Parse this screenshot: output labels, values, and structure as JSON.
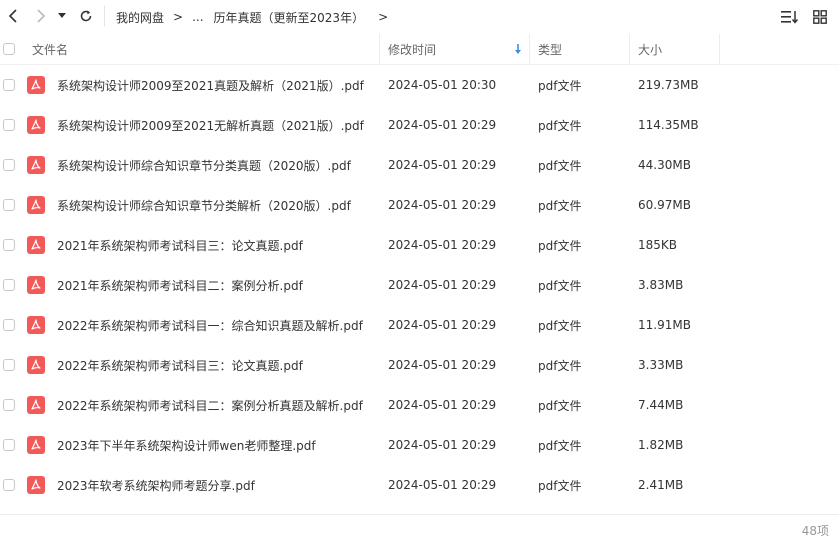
{
  "toolbar": {
    "breadcrumb": [
      "我的网盘",
      "...",
      "历年真题（更新至2023年）"
    ],
    "icons": [
      "back-icon",
      "forward-icon",
      "dropdown-icon",
      "refresh-icon",
      "sort-list-icon",
      "grid-view-icon"
    ]
  },
  "columns": {
    "name": "文件名",
    "modified": "修改时间",
    "type": "类型",
    "size": "大小"
  },
  "files": [
    {
      "name": "系统架构设计师2009至2021真题及解析（2021版）.pdf",
      "modified": "2024-05-01 20:30",
      "type": "pdf文件",
      "size": "219.73MB"
    },
    {
      "name": "系统架构设计师2009至2021无解析真题（2021版）.pdf",
      "modified": "2024-05-01 20:29",
      "type": "pdf文件",
      "size": "114.35MB"
    },
    {
      "name": "系统架构设计师综合知识章节分类真题（2020版）.pdf",
      "modified": "2024-05-01 20:29",
      "type": "pdf文件",
      "size": "44.30MB"
    },
    {
      "name": "系统架构设计师综合知识章节分类解析（2020版）.pdf",
      "modified": "2024-05-01 20:29",
      "type": "pdf文件",
      "size": "60.97MB"
    },
    {
      "name": "2021年系统架构师考试科目三：论文真题.pdf",
      "modified": "2024-05-01 20:29",
      "type": "pdf文件",
      "size": "185KB"
    },
    {
      "name": "2021年系统架构师考试科目二：案例分析.pdf",
      "modified": "2024-05-01 20:29",
      "type": "pdf文件",
      "size": "3.83MB"
    },
    {
      "name": "2022年系统架构师考试科目一：综合知识真题及解析.pdf",
      "modified": "2024-05-01 20:29",
      "type": "pdf文件",
      "size": "11.91MB"
    },
    {
      "name": "2022年系统架构师考试科目三：论文真题.pdf",
      "modified": "2024-05-01 20:29",
      "type": "pdf文件",
      "size": "3.33MB"
    },
    {
      "name": "2022年系统架构师考试科目二：案例分析真题及解析.pdf",
      "modified": "2024-05-01 20:29",
      "type": "pdf文件",
      "size": "7.44MB"
    },
    {
      "name": "2023年下半年系统架构设计师wen老师整理.pdf",
      "modified": "2024-05-01 20:29",
      "type": "pdf文件",
      "size": "1.82MB"
    },
    {
      "name": "2023年软考系统架构师考题分享.pdf",
      "modified": "2024-05-01 20:29",
      "type": "pdf文件",
      "size": "2.41MB"
    }
  ],
  "footer": {
    "count": "48项"
  },
  "colors": {
    "accent": "#3b8fe6",
    "pdf_red": "#f25a5a"
  }
}
